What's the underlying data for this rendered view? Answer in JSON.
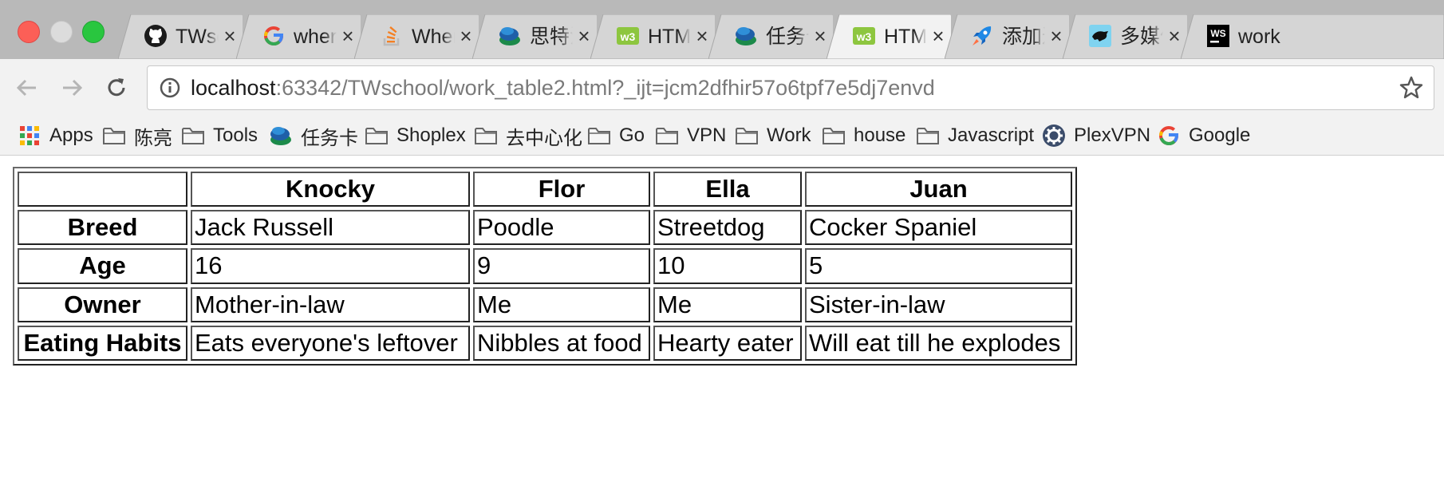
{
  "window": {
    "tabs": [
      {
        "title": "TWschool",
        "icon": "github-icon",
        "active": false
      },
      {
        "title": "where",
        "icon": "google-icon",
        "active": false
      },
      {
        "title": "Where",
        "icon": "stackoverflow-icon",
        "active": false
      },
      {
        "title": "思特沃克",
        "icon": "teambition-icon",
        "active": false
      },
      {
        "title": "HTML",
        "icon": "w3schools-icon",
        "active": false
      },
      {
        "title": "任务卡",
        "icon": "teambition-icon",
        "active": false
      },
      {
        "title": "HTML",
        "icon": "w3schools-icon",
        "active": true
      },
      {
        "title": "添加返回",
        "icon": "rocket-icon",
        "active": false
      },
      {
        "title": "多媒体",
        "icon": "panther-icon",
        "active": false
      },
      {
        "title": "work",
        "icon": "webstorm-icon",
        "active": false
      }
    ],
    "close_glyph": "×"
  },
  "toolbar": {
    "url_host": "localhost",
    "url_rest": ":63342/TWschool/work_table2.html?_ijt=jcm2dfhir57o6tpf7e5dj7envd"
  },
  "bookmarks": [
    {
      "label": "Apps",
      "icon": "apps-grid-icon"
    },
    {
      "label": "陈亮",
      "icon": "folder-icon"
    },
    {
      "label": "Tools",
      "icon": "folder-icon"
    },
    {
      "label": "任务卡",
      "icon": "teambition-icon"
    },
    {
      "label": "Shoplex",
      "icon": "folder-icon"
    },
    {
      "label": "去中心化",
      "icon": "folder-icon"
    },
    {
      "label": "Go",
      "icon": "folder-icon"
    },
    {
      "label": "VPN",
      "icon": "folder-icon"
    },
    {
      "label": "Work",
      "icon": "folder-icon"
    },
    {
      "label": "house",
      "icon": "folder-icon"
    },
    {
      "label": "Javascript",
      "icon": "folder-icon"
    },
    {
      "label": "PlexVPN",
      "icon": "gear-icon"
    },
    {
      "label": "Google",
      "icon": "google-icon"
    }
  ],
  "table": {
    "headers": [
      "",
      "Knocky",
      "Flor",
      "Ella",
      "Juan"
    ],
    "rows": [
      {
        "label": "Breed",
        "cells": [
          "Jack Russell",
          "Poodle",
          "Streetdog",
          "Cocker Spaniel"
        ]
      },
      {
        "label": "Age",
        "cells": [
          "16",
          "9",
          "10",
          "5"
        ]
      },
      {
        "label": "Owner",
        "cells": [
          "Mother-in-law",
          "Me",
          "Me",
          "Sister-in-law"
        ]
      },
      {
        "label": "Eating Habits",
        "cells": [
          "Eats everyone's leftover",
          "Nibbles at food",
          "Hearty eater",
          "Will eat till he explodes"
        ]
      }
    ]
  }
}
